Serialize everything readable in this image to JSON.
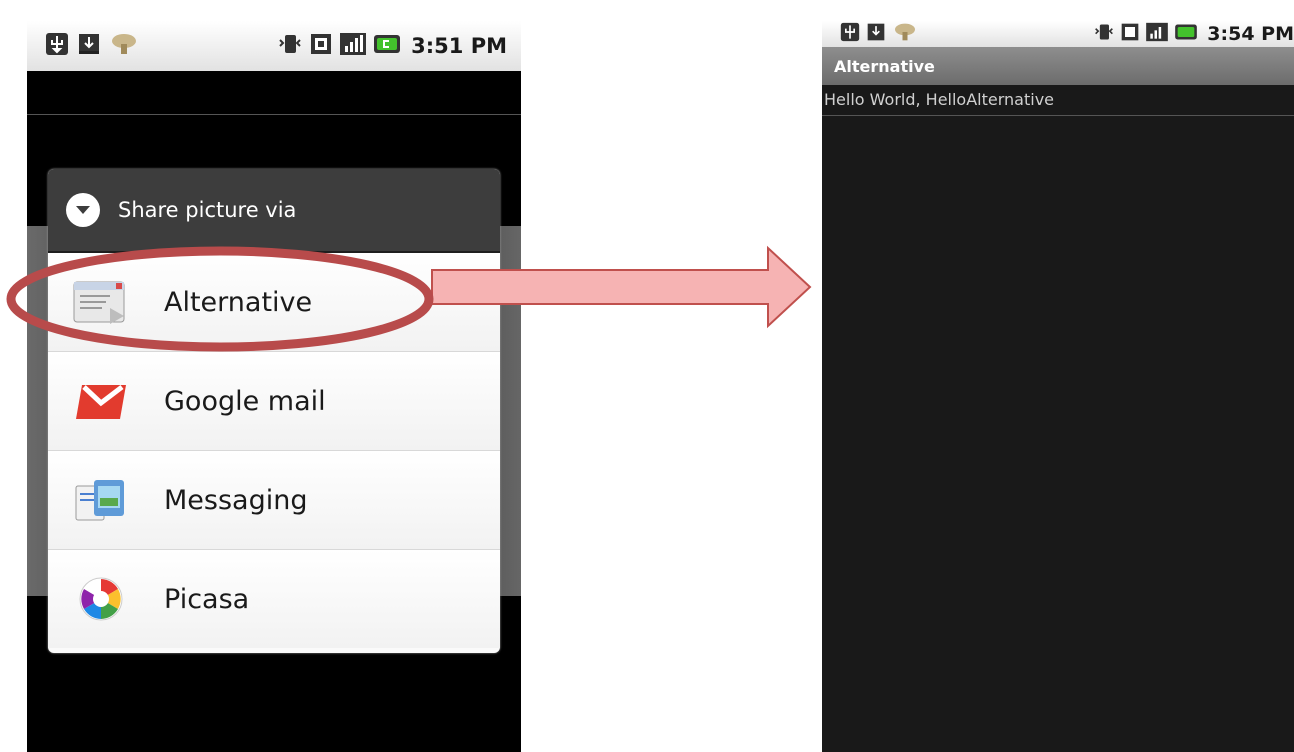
{
  "left_screen": {
    "status_bar": {
      "time": "3:51 PM",
      "left_icons": [
        "usb-icon",
        "download-icon",
        "mushroom-icon"
      ],
      "right_icons": [
        "vibrate-icon",
        "sim-icon",
        "signal-icon",
        "battery-icon"
      ]
    },
    "dialog": {
      "title": "Share picture via",
      "items": [
        {
          "label": "Alternative",
          "icon": "alternative-app-icon",
          "highlighted": true
        },
        {
          "label": "Google mail",
          "icon": "gmail-icon"
        },
        {
          "label": "Messaging",
          "icon": "messaging-icon"
        },
        {
          "label": "Picasa",
          "icon": "picasa-icon"
        }
      ]
    }
  },
  "right_screen": {
    "status_bar": {
      "time": "3:54 PM"
    },
    "title": "Alternative",
    "content_text": "Hello World, HelloAlternative"
  },
  "colors": {
    "highlight_ellipse": "#b84b4b",
    "arrow_fill": "#f6b3b3",
    "arrow_stroke": "#c0504d",
    "dialog_title_bg": "#3d3d3d",
    "app_bg": "#191919"
  }
}
